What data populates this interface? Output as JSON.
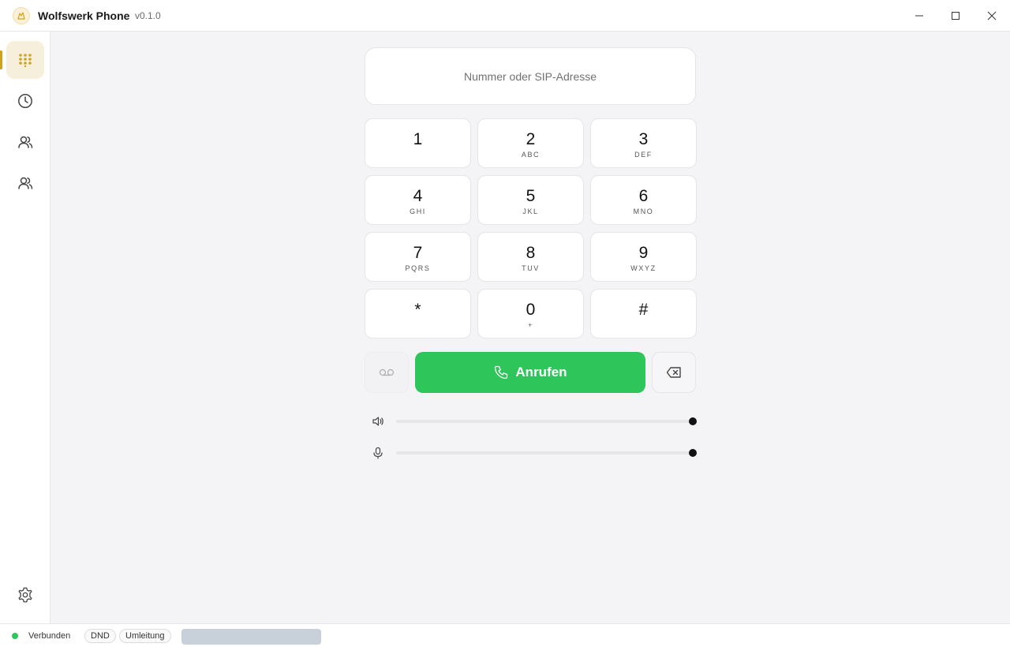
{
  "titlebar": {
    "title": "Wolfswerk Phone",
    "version": "v0.1.0",
    "logo_icon": "wolf-logo-icon"
  },
  "sidebar": {
    "items": [
      {
        "name": "dialpad",
        "icon": "dialpad-icon",
        "active": true
      },
      {
        "name": "history",
        "icon": "clock-icon",
        "active": false
      },
      {
        "name": "contacts",
        "icon": "users-icon",
        "active": false
      },
      {
        "name": "groups",
        "icon": "users-icon",
        "active": false
      }
    ],
    "settings_icon": "gear-icon",
    "accent_color": "#d3a21c"
  },
  "dialer": {
    "placeholder": "Nummer oder SIP-Adresse",
    "value": "",
    "keys": [
      {
        "digit": "1",
        "letters": ""
      },
      {
        "digit": "2",
        "letters": "ABC"
      },
      {
        "digit": "3",
        "letters": "DEF"
      },
      {
        "digit": "4",
        "letters": "GHI"
      },
      {
        "digit": "5",
        "letters": "JKL"
      },
      {
        "digit": "6",
        "letters": "MNO"
      },
      {
        "digit": "7",
        "letters": "PQRS"
      },
      {
        "digit": "8",
        "letters": "TUV"
      },
      {
        "digit": "9",
        "letters": "WXYZ"
      },
      {
        "digit": "*",
        "letters": ""
      },
      {
        "digit": "0",
        "letters": "+"
      },
      {
        "digit": "#",
        "letters": ""
      }
    ],
    "call_label": "Anrufen",
    "call_color": "#2ec55a"
  },
  "audio": {
    "speaker_volume": 1.0,
    "mic_volume": 1.0
  },
  "status": {
    "connection": "Verbunden",
    "connection_color": "#2ec55a",
    "dnd_label": "DND",
    "forward_label": "Umleitung"
  }
}
